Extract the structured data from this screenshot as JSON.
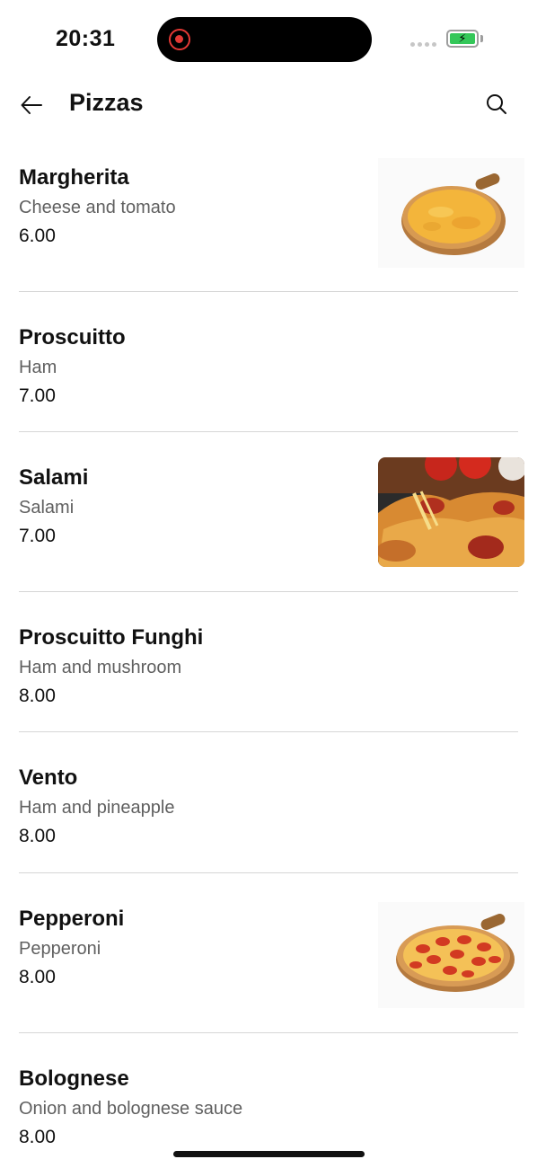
{
  "status_bar": {
    "time": "20:31",
    "battery": {
      "charging": true,
      "color": "#34c759"
    },
    "recording_indicator_color": "#e53935"
  },
  "app_bar": {
    "title": "Pizzas",
    "back_icon": "arrow-left-icon",
    "search_icon": "search-icon"
  },
  "items": [
    {
      "name": "Margherita",
      "description": "Cheese and tomato",
      "price": "6.00",
      "image": "pizza-margherita-image"
    },
    {
      "name": "Proscuitto",
      "description": "Ham",
      "price": "7.00",
      "image": null
    },
    {
      "name": "Salami",
      "description": "Salami",
      "price": "7.00",
      "image": "pizza-salami-photo"
    },
    {
      "name": "Proscuitto Funghi",
      "description": "Ham and mushroom",
      "price": "8.00",
      "image": null
    },
    {
      "name": "Vento",
      "description": "Ham and pineapple",
      "price": "8.00",
      "image": null
    },
    {
      "name": "Pepperoni",
      "description": "Pepperoni",
      "price": "8.00",
      "image": "pizza-pepperoni-image"
    },
    {
      "name": "Bolognese",
      "description": "Onion and bolognese sauce",
      "price": "8.00",
      "image": null
    }
  ]
}
